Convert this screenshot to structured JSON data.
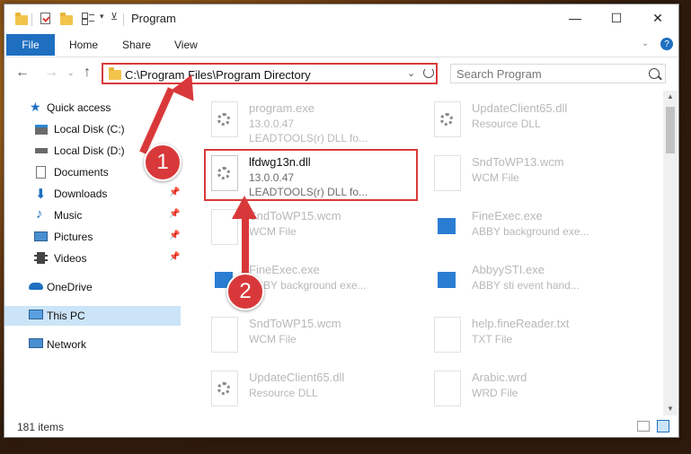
{
  "window": {
    "title": "Program"
  },
  "ribbon": {
    "file": "File",
    "tabs": [
      "Home",
      "Share",
      "View"
    ]
  },
  "address": {
    "path": "C:\\Program Files\\Program Directory"
  },
  "search": {
    "placeholder": "Search Program"
  },
  "sidebar": {
    "items": [
      {
        "label": "Quick access",
        "icon": "star-icon"
      },
      {
        "label": "Local Disk (C:)",
        "icon": "drive-icon"
      },
      {
        "label": "Local Disk (D:)",
        "icon": "drive-icon"
      },
      {
        "label": "Documents",
        "icon": "documents-icon"
      },
      {
        "label": "Downloads",
        "icon": "download-icon"
      },
      {
        "label": "Music",
        "icon": "music-icon"
      },
      {
        "label": "Pictures",
        "icon": "pictures-icon"
      },
      {
        "label": "Videos",
        "icon": "videos-icon"
      },
      {
        "label": "OneDrive",
        "icon": "cloud-icon"
      },
      {
        "label": "This PC",
        "icon": "computer-icon"
      },
      {
        "label": "Network",
        "icon": "network-icon"
      }
    ]
  },
  "files": [
    {
      "name": "program.exe",
      "line2": "13.0.0.47",
      "line3": "LEADTOOLS(r) DLL fo..."
    },
    {
      "name": "UpdateClient65.dll",
      "line2": "Resource DLL",
      "line3": ""
    },
    {
      "name": "lfdwg13n.dll",
      "line2": "13.0.0.47",
      "line3": "LEADTOOLS(r) DLL fo..."
    },
    {
      "name": "SndToWP13.wcm",
      "line2": "WCM File",
      "line3": ""
    },
    {
      "name": "SndToWP15.wcm",
      "line2": "WCM File",
      "line3": ""
    },
    {
      "name": "FineExec.exe",
      "line2": "ABBY background exe...",
      "line3": ""
    },
    {
      "name": "FineExec.exe",
      "line2": "ABBY background exe...",
      "line3": ""
    },
    {
      "name": "AbbyySTI.exe",
      "line2": "ABBY sti event hand...",
      "line3": ""
    },
    {
      "name": "SndToWP15.wcm",
      "line2": "WCM File",
      "line3": ""
    },
    {
      "name": "help.fineReader.txt",
      "line2": "TXT File",
      "line3": ""
    },
    {
      "name": "UpdateClient65.dll",
      "line2": "Resource DLL",
      "line3": ""
    },
    {
      "name": "Arabic.wrd",
      "line2": "WRD File",
      "line3": ""
    }
  ],
  "status": {
    "count": "181 items"
  },
  "annotations": {
    "step1": "1",
    "step2": "2"
  }
}
